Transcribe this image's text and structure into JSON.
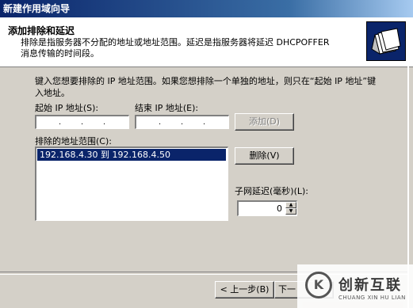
{
  "window": {
    "title": "新建作用域向导"
  },
  "header": {
    "title": "添加排除和延迟",
    "description": "排除是指服务器不分配的地址或地址范围。延迟是指服务器将延迟 DHCPOFFER 消息传输的时间段。"
  },
  "instructions": "键入您想要排除的 IP 地址范围。如果您想排除一个单独的地址，则只在“起始 IP 地址”键入地址。",
  "fields": {
    "start_ip_label": "起始 IP 地址(S):",
    "end_ip_label": "结束 IP 地址(E):",
    "start_ip_value": "",
    "end_ip_value": ""
  },
  "buttons": {
    "add": "添加(D)",
    "delete": "删除(V)",
    "back": "< 上一步(B)",
    "next": "下一"
  },
  "excluded_list": {
    "label": "排除的地址范围(C):",
    "items": [
      "192.168.4.30 到 192.168.4.50"
    ]
  },
  "delay": {
    "label": "子网延迟(毫秒)(L):",
    "value": "0"
  },
  "watermark": {
    "logo_text": "K",
    "name": "创新互联",
    "subtitle": "CHUANG XIN HU LIAN"
  }
}
